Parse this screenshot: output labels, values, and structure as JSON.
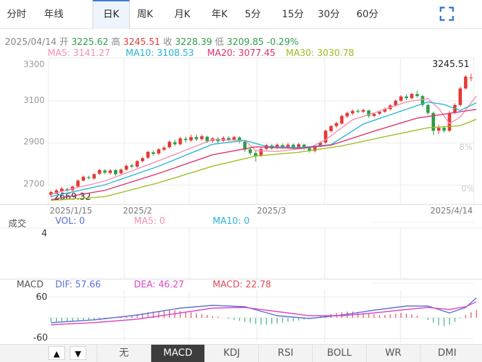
{
  "tabs": [
    {
      "label": "分时"
    },
    {
      "label": "年线"
    },
    {
      "label": "日K",
      "active": true
    },
    {
      "label": "周K"
    },
    {
      "label": "月K"
    },
    {
      "label": "年K"
    },
    {
      "label": "5分"
    },
    {
      "label": "15分"
    },
    {
      "label": "30分"
    },
    {
      "label": "60分"
    }
  ],
  "quote": {
    "date": "2025/04/14",
    "open_label": "开",
    "open": "3225.62",
    "high_label": "高",
    "high": "3245.51",
    "close_label": "收",
    "close": "3228.39",
    "low_label": "低",
    "low": "3209.85",
    "change": "-0.29%"
  },
  "ma_legend": {
    "ma5": "MA5: 3141.27",
    "ma10": "MA10: 3108.53",
    "ma20": "MA20: 3077.45",
    "ma30": "MA30: 3030.78"
  },
  "colors": {
    "up": "#e53935",
    "down": "#2e9e48",
    "ma5": "#f48fb1",
    "ma10": "#26b5d8",
    "ma20": "#e0306a",
    "ma30": "#9bbd1e",
    "dif": "#5a6fd6",
    "dea": "#d946c8",
    "macd": "#e04b5a"
  },
  "price_axis": [
    "3300",
    "3100",
    "2900",
    "2700"
  ],
  "pct_axis": [
    "8%",
    "0%"
  ],
  "date_axis": [
    "2025/1/15",
    "2025/2",
    "2025/3",
    "2025/4/14"
  ],
  "max_label": "3245.51",
  "min_label": "2669.32",
  "volume": {
    "title": "成交",
    "vol": "VOL: 0",
    "ma5": "MA5: 0",
    "ma10": "MA10: 0",
    "axis_top": "4"
  },
  "macd": {
    "title": "MACD",
    "dif": "DIF: 57.66",
    "dea": "DEA: 46.27",
    "macd": "MACD: 22.78",
    "axis_top": "60",
    "axis_bottom": "-60"
  },
  "nav": {
    "up": "▲",
    "down": "▼"
  },
  "indicators": [
    {
      "label": "无"
    },
    {
      "label": "MACD",
      "active": true
    },
    {
      "label": "KDJ"
    },
    {
      "label": "RSI"
    },
    {
      "label": "BOLL"
    },
    {
      "label": "WR"
    },
    {
      "label": "DMI"
    }
  ],
  "chart_data": {
    "type": "candlestick",
    "price_range": [
      2640,
      3320
    ],
    "candles": [
      [
        2672,
        2686,
        2660,
        2692
      ],
      [
        2684,
        2694,
        2676,
        2700
      ],
      [
        2690,
        2702,
        2682,
        2710
      ],
      [
        2700,
        2692,
        2688,
        2706
      ],
      [
        2694,
        2712,
        2690,
        2716
      ],
      [
        2712,
        2740,
        2708,
        2746
      ],
      [
        2740,
        2758,
        2736,
        2764
      ],
      [
        2756,
        2752,
        2746,
        2764
      ],
      [
        2750,
        2770,
        2744,
        2776
      ],
      [
        2772,
        2790,
        2766,
        2796
      ],
      [
        2788,
        2778,
        2770,
        2794
      ],
      [
        2776,
        2788,
        2768,
        2794
      ],
      [
        2790,
        2770,
        2762,
        2794
      ],
      [
        2774,
        2792,
        2768,
        2798
      ],
      [
        2792,
        2810,
        2786,
        2818
      ],
      [
        2812,
        2806,
        2798,
        2820
      ],
      [
        2806,
        2832,
        2800,
        2838
      ],
      [
        2832,
        2846,
        2826,
        2852
      ],
      [
        2848,
        2876,
        2842,
        2882
      ],
      [
        2874,
        2866,
        2858,
        2884
      ],
      [
        2868,
        2888,
        2862,
        2894
      ],
      [
        2886,
        2896,
        2880,
        2904
      ],
      [
        2898,
        2924,
        2892,
        2930
      ],
      [
        2922,
        2912,
        2904,
        2934
      ],
      [
        2912,
        2940,
        2906,
        2948
      ],
      [
        2938,
        2932,
        2920,
        2948
      ],
      [
        2930,
        2946,
        2924,
        2958
      ],
      [
        2946,
        2936,
        2928,
        2956
      ],
      [
        2936,
        2950,
        2930,
        2958
      ],
      [
        2948,
        2926,
        2918,
        2952
      ],
      [
        2928,
        2940,
        2920,
        2946
      ],
      [
        2938,
        2926,
        2918,
        2946
      ],
      [
        2928,
        2942,
        2922,
        2950
      ],
      [
        2942,
        2934,
        2926,
        2950
      ],
      [
        2934,
        2946,
        2928,
        2952
      ],
      [
        2944,
        2926,
        2916,
        2950
      ],
      [
        2924,
        2886,
        2876,
        2930
      ],
      [
        2888,
        2870,
        2860,
        2896
      ],
      [
        2870,
        2856,
        2830,
        2880
      ],
      [
        2858,
        2890,
        2852,
        2896
      ],
      [
        2890,
        2908,
        2884,
        2914
      ],
      [
        2906,
        2892,
        2886,
        2912
      ],
      [
        2894,
        2910,
        2888,
        2916
      ],
      [
        2908,
        2898,
        2890,
        2916
      ],
      [
        2898,
        2910,
        2892,
        2918
      ],
      [
        2910,
        2898,
        2890,
        2916
      ],
      [
        2896,
        2912,
        2890,
        2918
      ],
      [
        2910,
        2894,
        2886,
        2914
      ],
      [
        2894,
        2880,
        2872,
        2898
      ],
      [
        2880,
        2904,
        2874,
        2910
      ],
      [
        2904,
        2920,
        2898,
        2926
      ],
      [
        2920,
        2976,
        2914,
        2982
      ],
      [
        2974,
        2998,
        2968,
        3004
      ],
      [
        2998,
        3012,
        2990,
        3018
      ],
      [
        3010,
        3046,
        3004,
        3052
      ],
      [
        3044,
        3060,
        3036,
        3066
      ],
      [
        3058,
        3070,
        3050,
        3076
      ],
      [
        3070,
        3066,
        3058,
        3078
      ],
      [
        3066,
        3074,
        3060,
        3080
      ],
      [
        3072,
        3046,
        3036,
        3076
      ],
      [
        3046,
        3056,
        3040,
        3062
      ],
      [
        3056,
        3066,
        3050,
        3070
      ],
      [
        3066,
        3080,
        3060,
        3086
      ],
      [
        3078,
        3096,
        3072,
        3102
      ],
      [
        3096,
        3118,
        3090,
        3124
      ],
      [
        3118,
        3138,
        3112,
        3144
      ],
      [
        3138,
        3130,
        3120,
        3148
      ],
      [
        3130,
        3150,
        3124,
        3156
      ],
      [
        3150,
        3140,
        3132,
        3166
      ],
      [
        3140,
        3098,
        3088,
        3146
      ],
      [
        3098,
        3060,
        3050,
        3104
      ],
      [
        3060,
        2976,
        2956,
        3066
      ],
      [
        2976,
        2990,
        2960,
        3004
      ],
      [
        2990,
        2976,
        2966,
        3000
      ],
      [
        2976,
        3060,
        2970,
        3068
      ],
      [
        3060,
        3098,
        3054,
        3106
      ],
      [
        3098,
        3176,
        3090,
        3184
      ],
      [
        3176,
        3232,
        3170,
        3240
      ],
      [
        3226,
        3228,
        3210,
        3246
      ]
    ],
    "ma_series": {
      "MA5": [
        [
          0,
          2676
        ],
        [
          10,
          2738
        ],
        [
          20,
          2834
        ],
        [
          30,
          2934
        ],
        [
          36,
          2930
        ],
        [
          38,
          2882
        ],
        [
          42,
          2878
        ],
        [
          48,
          2896
        ],
        [
          51,
          2934
        ],
        [
          56,
          3028
        ],
        [
          60,
          3060
        ],
        [
          66,
          3112
        ],
        [
          70,
          3128
        ],
        [
          72,
          3082
        ],
        [
          74,
          3010
        ],
        [
          76,
          3040
        ],
        [
          79,
          3141
        ]
      ],
      "MA10": [
        [
          0,
          2664
        ],
        [
          10,
          2720
        ],
        [
          20,
          2808
        ],
        [
          30,
          2912
        ],
        [
          36,
          2930
        ],
        [
          40,
          2902
        ],
        [
          46,
          2896
        ],
        [
          52,
          2910
        ],
        [
          58,
          3008
        ],
        [
          64,
          3060
        ],
        [
          70,
          3112
        ],
        [
          73,
          3100
        ],
        [
          76,
          3072
        ],
        [
          79,
          3108
        ]
      ],
      "MA20": [
        [
          0,
          2650
        ],
        [
          10,
          2694
        ],
        [
          20,
          2774
        ],
        [
          30,
          2862
        ],
        [
          38,
          2900
        ],
        [
          46,
          2892
        ],
        [
          52,
          2908
        ],
        [
          60,
          2974
        ],
        [
          68,
          3036
        ],
        [
          74,
          3058
        ],
        [
          79,
          3077
        ]
      ],
      "MA30": [
        [
          0,
          2646
        ],
        [
          10,
          2664
        ],
        [
          20,
          2730
        ],
        [
          30,
          2808
        ],
        [
          38,
          2856
        ],
        [
          46,
          2874
        ],
        [
          54,
          2904
        ],
        [
          62,
          2948
        ],
        [
          70,
          2990
        ],
        [
          76,
          3000
        ],
        [
          79,
          3030
        ]
      ]
    },
    "macd_range": [
      -60,
      60
    ],
    "dif": [
      [
        0,
        -14
      ],
      [
        8,
        -6
      ],
      [
        16,
        8
      ],
      [
        24,
        28
      ],
      [
        30,
        36
      ],
      [
        36,
        32
      ],
      [
        42,
        6
      ],
      [
        48,
        -2
      ],
      [
        54,
        8
      ],
      [
        60,
        22
      ],
      [
        66,
        34
      ],
      [
        70,
        34
      ],
      [
        74,
        14
      ],
      [
        77,
        30
      ],
      [
        79,
        57.66
      ]
    ],
    "dea": [
      [
        0,
        -20
      ],
      [
        8,
        -14
      ],
      [
        16,
        -4
      ],
      [
        24,
        14
      ],
      [
        30,
        28
      ],
      [
        36,
        30
      ],
      [
        42,
        18
      ],
      [
        48,
        6
      ],
      [
        54,
        6
      ],
      [
        60,
        14
      ],
      [
        66,
        24
      ],
      [
        70,
        30
      ],
      [
        74,
        24
      ],
      [
        77,
        32
      ],
      [
        79,
        46.27
      ]
    ],
    "histogram": [
      -12,
      -11,
      -10,
      -10,
      -9,
      -8,
      -7,
      -6,
      -6,
      -5,
      -4,
      -2,
      0,
      3,
      5,
      7,
      10,
      13,
      16,
      18,
      20,
      22,
      22,
      22,
      20,
      18,
      16,
      13,
      11,
      8,
      5,
      3,
      0,
      -3,
      -6,
      -9,
      -12,
      -15,
      -18,
      -20,
      -20,
      -18,
      -16,
      -14,
      -12,
      -10,
      -8,
      -5,
      -2,
      0,
      4,
      8,
      12,
      14,
      16,
      18,
      18,
      16,
      14,
      12,
      10,
      8,
      8,
      10,
      12,
      14,
      12,
      10,
      6,
      0,
      -6,
      -14,
      -22,
      -24,
      -20,
      -12,
      -2,
      8,
      16,
      22.78
    ]
  }
}
